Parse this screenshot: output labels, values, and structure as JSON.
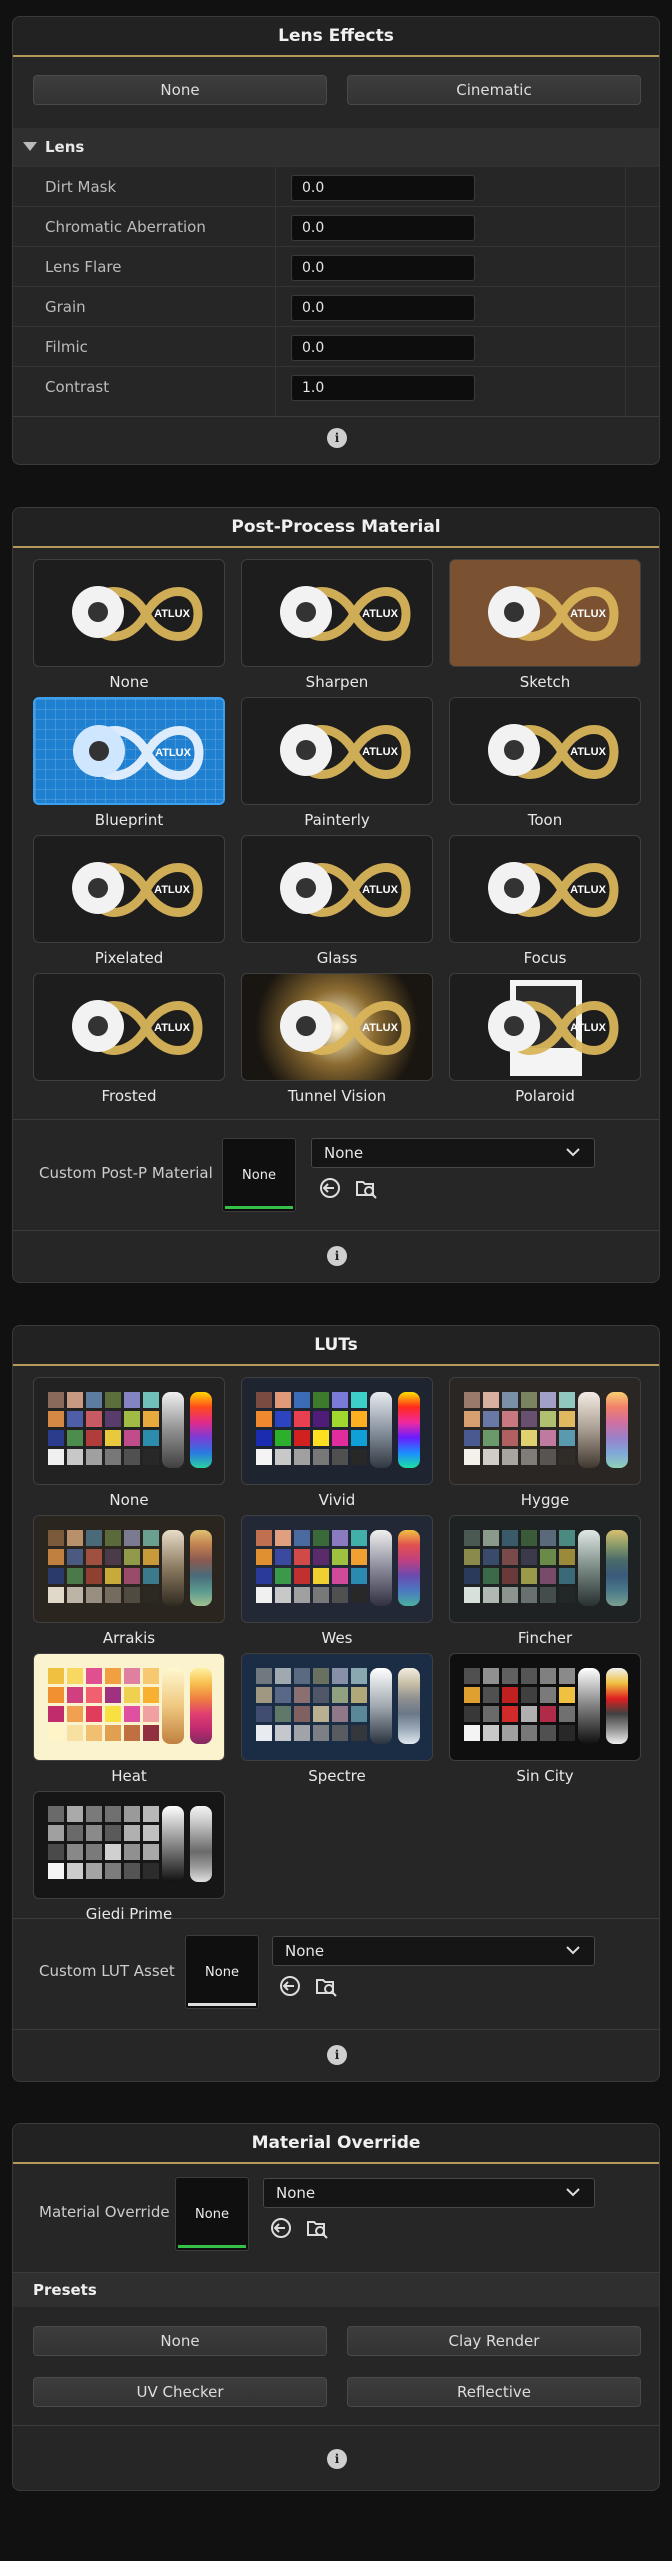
{
  "lens_effects": {
    "title": "Lens Effects",
    "buttons": [
      "None",
      "Cinematic"
    ],
    "section": "Lens",
    "properties": [
      {
        "label": "Dirt Mask",
        "value": "0.0"
      },
      {
        "label": "Chromatic Aberration",
        "value": "0.0"
      },
      {
        "label": "Lens Flare",
        "value": "0.0"
      },
      {
        "label": "Grain",
        "value": "0.0"
      },
      {
        "label": "Filmic",
        "value": "0.0"
      },
      {
        "label": "Contrast",
        "value": "1.0"
      }
    ]
  },
  "post_process": {
    "title": "Post-Process Material",
    "logo_text": "ATLUX",
    "tiles": [
      "None",
      "Sharpen",
      "Sketch",
      "Blueprint",
      "Painterly",
      "Toon",
      "Pixelated",
      "Glass",
      "Focus",
      "Frosted",
      "Tunnel Vision",
      "Polaroid"
    ],
    "custom_label": "Custom Post-P Material",
    "custom_value": "None",
    "dropdown_value": "None"
  },
  "luts": {
    "title": "LUTs",
    "tiles": [
      "None",
      "Vivid",
      "Hygge",
      "Arrakis",
      "Wes",
      "Fincher",
      "Heat",
      "Spectre",
      "Sin City",
      "Giedi Prime"
    ],
    "custom_label": "Custom LUT Asset",
    "custom_value": "None",
    "dropdown_value": "None"
  },
  "material_override": {
    "title": "Material Override",
    "label": "Material Override",
    "value": "None",
    "dropdown_value": "None",
    "presets_title": "Presets",
    "presets": [
      "None",
      "Clay Render",
      "UV Checker",
      "Reflective"
    ]
  },
  "info_glyph": "i",
  "colors": {
    "accent": "#b59a57",
    "active_green": "#35c04a",
    "blueprint": "#1f7fd0"
  }
}
